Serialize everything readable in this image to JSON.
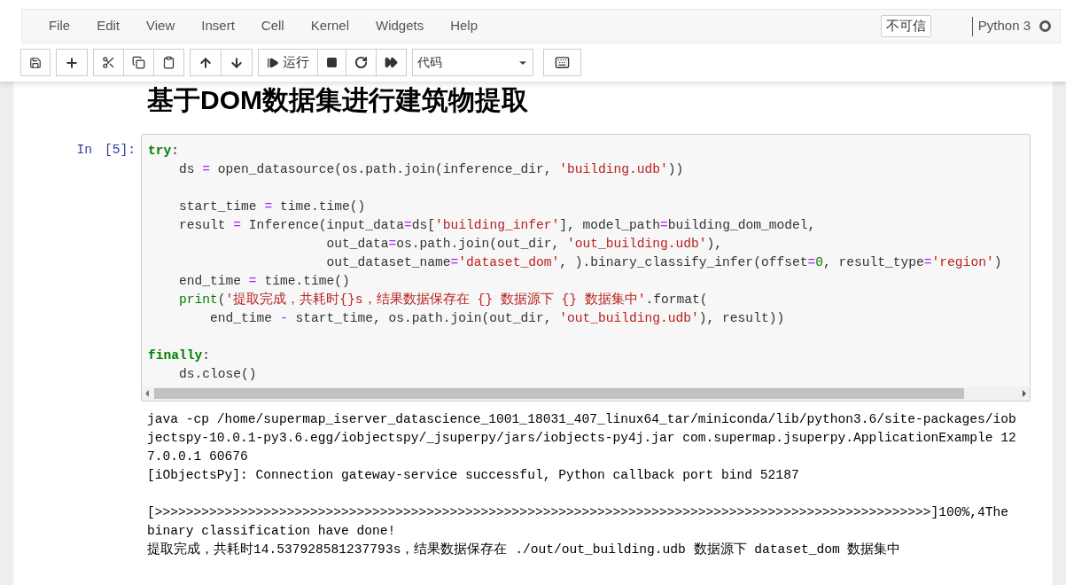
{
  "menu": [
    "File",
    "Edit",
    "View",
    "Insert",
    "Cell",
    "Kernel",
    "Widgets",
    "Help"
  ],
  "trust_button": "不可信",
  "kernel": {
    "name": "Python 3",
    "busy": false
  },
  "toolbar": {
    "run_label": "运行",
    "cell_type": "代码"
  },
  "heading": "基于DOM数据集进行建筑物提取",
  "cell": {
    "prompt": "In",
    "count": "[5]:",
    "code_lines": [
      {
        "blank_before": false,
        "tokens": [
          {
            "kind": "keyword",
            "text": "try"
          },
          {
            "kind": "plain",
            "text": ":"
          }
        ]
      },
      {
        "blank_before": false,
        "tokens": [
          {
            "kind": "plain",
            "text": "    ds "
          },
          {
            "kind": "operator",
            "text": "="
          },
          {
            "kind": "plain",
            "text": " open_datasource(os.path.join(inference_dir, "
          },
          {
            "kind": "string",
            "text": "'building.udb'"
          },
          {
            "kind": "plain",
            "text": "))"
          }
        ]
      },
      {
        "blank_before": true,
        "tokens": [
          {
            "kind": "plain",
            "text": "    start_time "
          },
          {
            "kind": "operator",
            "text": "="
          },
          {
            "kind": "plain",
            "text": " time.time()"
          }
        ]
      },
      {
        "blank_before": false,
        "tokens": [
          {
            "kind": "plain",
            "text": "    result "
          },
          {
            "kind": "operator",
            "text": "="
          },
          {
            "kind": "plain",
            "text": " Inference(input_data"
          },
          {
            "kind": "operator",
            "text": "="
          },
          {
            "kind": "plain",
            "text": "ds["
          },
          {
            "kind": "string",
            "text": "'building_infer'"
          },
          {
            "kind": "plain",
            "text": "], model_path"
          },
          {
            "kind": "operator",
            "text": "="
          },
          {
            "kind": "plain",
            "text": "building_dom_model,"
          }
        ]
      },
      {
        "blank_before": false,
        "tokens": [
          {
            "kind": "plain",
            "text": "                       out_data"
          },
          {
            "kind": "operator",
            "text": "="
          },
          {
            "kind": "plain",
            "text": "os.path.join(out_dir, "
          },
          {
            "kind": "string",
            "text": "'out_building.udb'"
          },
          {
            "kind": "plain",
            "text": "),"
          }
        ]
      },
      {
        "blank_before": false,
        "tokens": [
          {
            "kind": "plain",
            "text": "                       out_dataset_name"
          },
          {
            "kind": "operator",
            "text": "="
          },
          {
            "kind": "string",
            "text": "'dataset_dom'"
          },
          {
            "kind": "plain",
            "text": ", ).binary_classify_infer(offset"
          },
          {
            "kind": "operator",
            "text": "="
          },
          {
            "kind": "number",
            "text": "0"
          },
          {
            "kind": "plain",
            "text": ", result_type"
          },
          {
            "kind": "operator",
            "text": "="
          },
          {
            "kind": "string",
            "text": "'region'"
          },
          {
            "kind": "plain",
            "text": ")"
          }
        ]
      },
      {
        "blank_before": false,
        "tokens": [
          {
            "kind": "plain",
            "text": "    end_time "
          },
          {
            "kind": "operator",
            "text": "="
          },
          {
            "kind": "plain",
            "text": " time.time()"
          }
        ]
      },
      {
        "blank_before": false,
        "tokens": [
          {
            "kind": "builtin",
            "text": "    print"
          },
          {
            "kind": "plain",
            "text": "("
          },
          {
            "kind": "string",
            "text": "'提取完成，共耗时{}s，结果数据保存在 {} 数据源下 {} 数据集中'"
          },
          {
            "kind": "plain",
            "text": ".format("
          }
        ]
      },
      {
        "blank_before": false,
        "tokens": [
          {
            "kind": "plain",
            "text": "        end_time "
          },
          {
            "kind": "operator",
            "text": "-"
          },
          {
            "kind": "plain",
            "text": " start_time, os.path.join(out_dir, "
          },
          {
            "kind": "string",
            "text": "'out_building.udb'"
          },
          {
            "kind": "plain",
            "text": "), result))"
          }
        ]
      },
      {
        "blank_before": true,
        "tokens": [
          {
            "kind": "keyword",
            "text": "finally"
          },
          {
            "kind": "plain",
            "text": ":"
          }
        ]
      },
      {
        "blank_before": false,
        "tokens": [
          {
            "kind": "plain",
            "text": "    ds.close()"
          }
        ]
      }
    ]
  },
  "output_lines": [
    {
      "blank_before": false,
      "text": "java -cp /home/supermap_iserver_datascience_1001_18031_407_linux64_tar/miniconda/lib/python3.6/site-packages/iob"
    },
    {
      "blank_before": false,
      "text": "jectspy-10.0.1-py3.6.egg/iobjectspy/_jsuperpy/jars/iobjects-py4j.jar com.supermap.jsuperpy.ApplicationExample 12"
    },
    {
      "blank_before": false,
      "text": "7.0.0.1 60676"
    },
    {
      "blank_before": false,
      "text": "[iObjectsPy]: Connection gateway-service successful, Python callback port bind 52187"
    },
    {
      "blank_before": true,
      "text": "[>>>>>>>>>>>>>>>>>>>>>>>>>>>>>>>>>>>>>>>>>>>>>>>>>>>>>>>>>>>>>>>>>>>>>>>>>>>>>>>>>>>>>>>>>>>>>>>>>>>>]100%,4The"
    },
    {
      "blank_before": false,
      "text": "binary classification have done!"
    },
    {
      "blank_before": false,
      "text": "提取完成，共耗时14.537928581237793s，结果数据保存在 ./out/out_building.udb 数据源下 dataset_dom 数据集中"
    }
  ]
}
